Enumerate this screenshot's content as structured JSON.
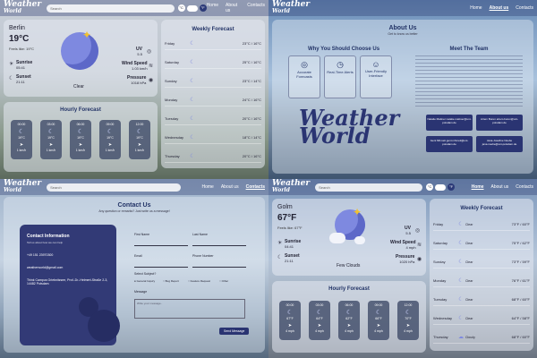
{
  "nav": {
    "logo_top": "Weather",
    "logo_bottom": "World",
    "search_placeholder": "Search",
    "unit_c": "°C",
    "unit_f": "°F",
    "links": [
      "Home",
      "About us",
      "Contacts"
    ]
  },
  "q1": {
    "city": "Berlin",
    "temp": "19°C",
    "feels": "Feels like: 19°C",
    "condition": "Clear",
    "sunrise_label": "Sunrise",
    "sunrise": "05:41",
    "sunset_label": "Sunset",
    "sunset": "21:11",
    "uv_label": "UV",
    "uv": "5.5",
    "wind_label": "Wind Speed",
    "wind": "1.03 km/h",
    "pressure_label": "Pressure",
    "pressure": "1018 hPa",
    "weekly_title": "Weekly Forecast",
    "weekly": [
      {
        "day": "Friday",
        "temp": "23°C / 16°C"
      },
      {
        "day": "Saturday",
        "temp": "25°C / 16°C"
      },
      {
        "day": "Sunday",
        "temp": "23°C / 14°C"
      },
      {
        "day": "Monday",
        "temp": "24°C / 16°C"
      },
      {
        "day": "Tuesday",
        "temp": "20°C / 16°C"
      },
      {
        "day": "Wednesday",
        "temp": "18°C / 14°C"
      },
      {
        "day": "Thursday",
        "temp": "20°C / 16°C"
      }
    ],
    "hourly_title": "Hourly Forecast",
    "hourly": [
      {
        "time": "00:00",
        "temp": "19°C",
        "wind": "1 km/h"
      },
      {
        "time": "03:00",
        "temp": "19°C",
        "wind": "1 km/h"
      },
      {
        "time": "06:00",
        "temp": "19°C",
        "wind": "1 km/h"
      },
      {
        "time": "09:00",
        "temp": "19°C",
        "wind": "1 km/h"
      },
      {
        "time": "12:00",
        "temp": "19°C",
        "wind": "1 km/h"
      }
    ]
  },
  "q2": {
    "title": "About Us",
    "subtitle": "Get to know us better",
    "why_title": "Why You Should Choose Us",
    "features": [
      "Accurate Forecasts",
      "Real-Time Alerts",
      "User-Friendly Interface"
    ],
    "team_title": "Meet The Team",
    "team": [
      "Natalie Mattner natalie.mattner@uni-potsdam.de",
      "Artem Buren artem.buren@uni-potsdam.de",
      "Gent Mhmeti gent.mhmeti@uni-potsdam.de",
      "Jana-Josefine Noebe jana.noebe@uni-potsdam.de"
    ],
    "big_logo_top": "Weather",
    "big_logo_bottom": "World"
  },
  "q3": {
    "title": "Contact Us",
    "subtitle": "Any question or remarks? Just write us a message!",
    "panel_title": "Contact Information",
    "panel_sub": "Tell us about how we can help",
    "phone": "+49 151 23970300",
    "email": "weatherworld@gmail.com",
    "address": "Think Campus Griebnitzsee, Prof.-Dr.-Helmert-Straße 2-3, 14482 Potsdam",
    "first_name": "First Name",
    "last_name": "Last Name",
    "email_label": "Email",
    "phone_label": "Phone Number",
    "subject_label": "Select Subject?",
    "subjects": [
      "General Inquiry",
      "Bug Report",
      "Feature Request",
      "Other"
    ],
    "message_label": "Message",
    "message_placeholder": "Write your message..",
    "send": "Send Message"
  },
  "q4": {
    "city": "Golm",
    "temp": "67°F",
    "feels": "Feels like: 67°F",
    "condition": "Few Clouds",
    "sunrise_label": "Sunrise",
    "sunrise": "04:41",
    "sunset_label": "Sunset",
    "sunset": "21:11",
    "uv_label": "UV",
    "uv": "5.5",
    "wind_label": "Wind Speed",
    "wind": "4 mph",
    "pressure_label": "Pressure",
    "pressure": "1020 hPa",
    "weekly_title": "Weekly Forecast",
    "weekly": [
      {
        "day": "Friday",
        "desc": "Clear",
        "temp": "73°F / 60°F"
      },
      {
        "day": "Saturday",
        "desc": "Clear",
        "temp": "75°F / 62°F"
      },
      {
        "day": "Sunday",
        "desc": "Clear",
        "temp": "73°F / 59°F"
      },
      {
        "day": "Monday",
        "desc": "Clear",
        "temp": "76°F / 61°F"
      },
      {
        "day": "Tuesday",
        "desc": "Clear",
        "temp": "68°F / 60°F"
      },
      {
        "day": "Wednesday",
        "desc": "Clear",
        "temp": "64°F / 58°F"
      },
      {
        "day": "Thursday",
        "desc": "Cloudy",
        "temp": "68°F / 60°F"
      }
    ],
    "hourly_title": "Hourly Forecast",
    "hourly": [
      {
        "time": "00:00",
        "temp": "67°F",
        "wind": "4 mph"
      },
      {
        "time": "03:00",
        "temp": "64°F",
        "wind": "4 mph"
      },
      {
        "time": "06:00",
        "temp": "62°F",
        "wind": "4 mph"
      },
      {
        "time": "09:00",
        "temp": "66°F",
        "wind": "4 mph"
      },
      {
        "time": "12:00",
        "temp": "70°F",
        "wind": "4 mph"
      }
    ]
  }
}
